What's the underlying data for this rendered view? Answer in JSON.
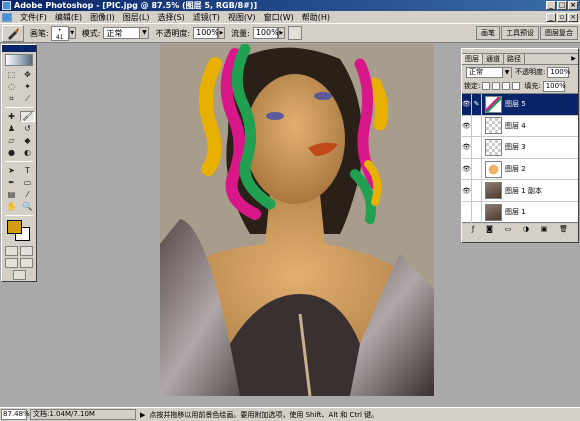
{
  "window": {
    "title": "Adobe Photoshop - [PIC.jpg @ 87.5% (图层 5, RGB/8#)]"
  },
  "menu": [
    "文件(F)",
    "编辑(E)",
    "图像(I)",
    "图层(L)",
    "选择(S)",
    "滤镜(T)",
    "视图(V)",
    "窗口(W)",
    "帮助(H)"
  ],
  "options": {
    "brush_label": "画笔:",
    "brush_size": "41",
    "mode_label": "模式:",
    "mode_value": "正常",
    "opacity_label": "不透明度:",
    "opacity_value": "100%",
    "flow_label": "流量:",
    "flow_value": "100%",
    "palette_well": [
      "画笔",
      "工具预设",
      "图层复合"
    ]
  },
  "colors": {
    "foreground": "#d29c10",
    "background": "#ffffff",
    "selection": "#0a246a"
  },
  "layers_palette": {
    "tabs": [
      "图层",
      "通道",
      "路径"
    ],
    "blend_mode": "正常",
    "opacity_label": "不透明度:",
    "opacity_value": "100%",
    "lock_label": "锁定:",
    "fill_label": "填充:",
    "fill_value": "100%",
    "layers": [
      {
        "name": "图层 5",
        "visible": true,
        "selected": true,
        "thumb": "paint-strokes"
      },
      {
        "name": "图层 4",
        "visible": true,
        "selected": false,
        "thumb": "transparent"
      },
      {
        "name": "图层 3",
        "visible": true,
        "selected": false,
        "thumb": "transparent"
      },
      {
        "name": "图层 2",
        "visible": true,
        "selected": false,
        "thumb": "orange-fill"
      },
      {
        "name": "图层 1 副本",
        "visible": true,
        "selected": false,
        "thumb": "photo"
      },
      {
        "name": "图层 1",
        "visible": false,
        "selected": false,
        "thumb": "photo"
      }
    ]
  },
  "status": {
    "zoom": "87.48%",
    "doc_size": "文档:1.04M/7.10M",
    "hint": "点按并拖移以用前景色绘画。要用附加选项，使用 Shift、Alt 和 Ctrl 键。"
  }
}
